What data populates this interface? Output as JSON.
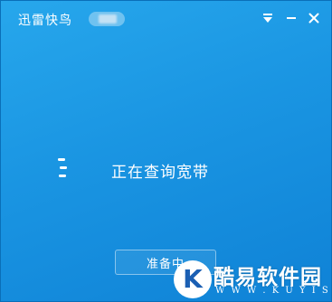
{
  "window": {
    "title": "迅雷快鸟",
    "controls": [
      "menu-icon",
      "minimize-icon",
      "close-icon"
    ]
  },
  "main": {
    "status_text": "正在查询宽带",
    "button_label": "准备中"
  },
  "watermark": {
    "badge_letter": "K",
    "name": "酷易软件园",
    "url": "W W W . K U Y I S O F T . C O M"
  },
  "colors": {
    "background_top": "#27a7ec",
    "background_bottom": "#0f82d6",
    "text": "#ffffff"
  }
}
